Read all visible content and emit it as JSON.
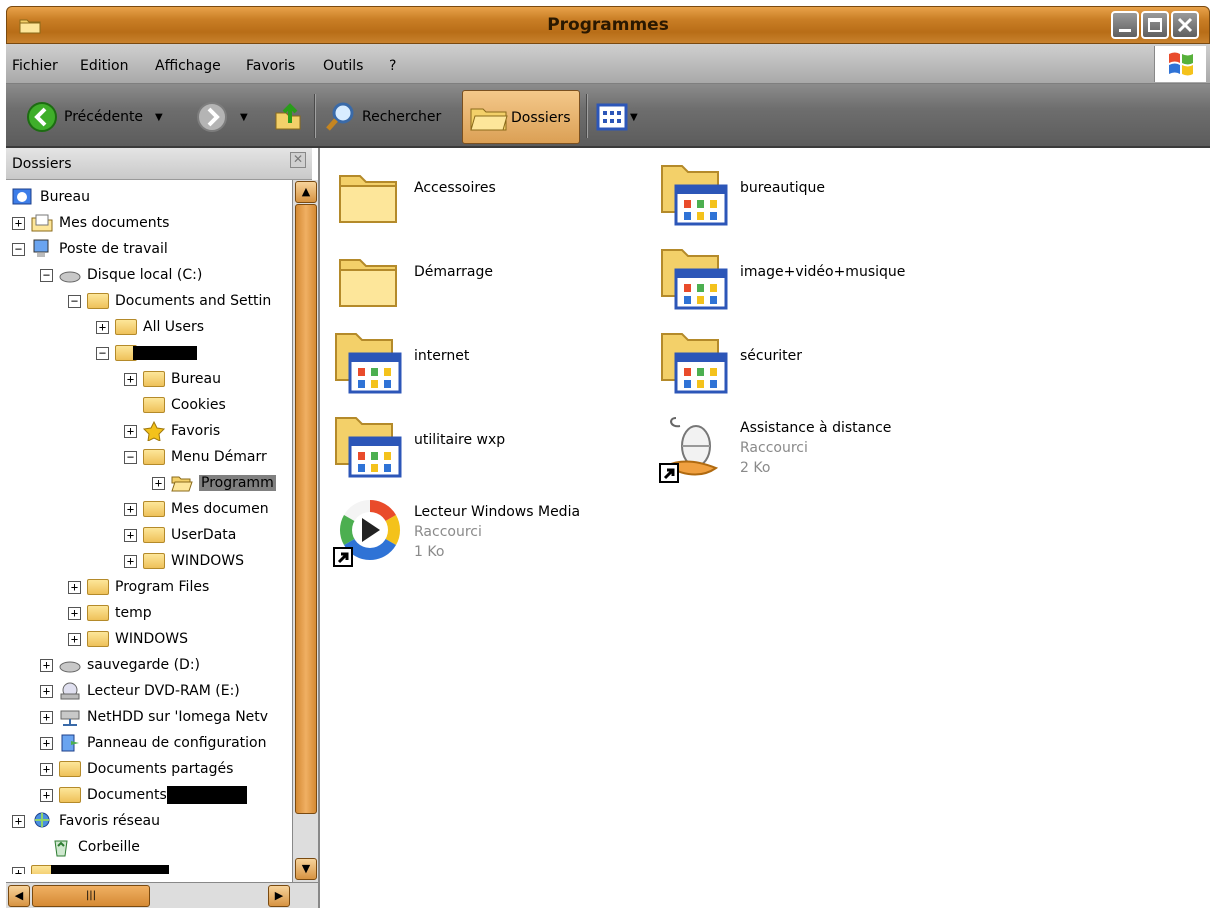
{
  "window": {
    "title": "Programmes",
    "accent": "#c97e25"
  },
  "menubar": {
    "items": [
      "Fichier",
      "Edition",
      "Affichage",
      "Favoris",
      "Outils",
      "?"
    ]
  },
  "toolbar": {
    "back_label": "Précédente",
    "search_label": "Rechercher",
    "folders_label": "Dossiers"
  },
  "folder_pane": {
    "header": "Dossiers",
    "tree": [
      {
        "label": "Bureau",
        "icon": "desktop-icon"
      },
      {
        "label": "Mes documents",
        "icon": "documents-icon"
      },
      {
        "label": "Poste de travail",
        "icon": "computer-icon"
      },
      {
        "label": "Disque local (C:)",
        "icon": "drive-icon"
      },
      {
        "label": "Documents and Settin",
        "icon": "folder-icon"
      },
      {
        "label": "All Users",
        "icon": "folder-icon"
      },
      {
        "label": "",
        "icon": "folder-icon"
      },
      {
        "label": "Bureau",
        "icon": "folder-icon"
      },
      {
        "label": "Cookies",
        "icon": "folder-icon"
      },
      {
        "label": "Favoris",
        "icon": "star-icon"
      },
      {
        "label": "Menu Démarr",
        "icon": "folder-icon"
      },
      {
        "label": "Programm",
        "icon": "folder-open-icon"
      },
      {
        "label": "Mes documen",
        "icon": "folder-icon"
      },
      {
        "label": "UserData",
        "icon": "folder-icon"
      },
      {
        "label": "WINDOWS",
        "icon": "folder-icon"
      },
      {
        "label": "Program Files",
        "icon": "folder-icon"
      },
      {
        "label": "temp",
        "icon": "folder-icon"
      },
      {
        "label": "WINDOWS",
        "icon": "folder-icon"
      },
      {
        "label": "sauvegarde (D:)",
        "icon": "drive-icon"
      },
      {
        "label": "Lecteur DVD-RAM (E:)",
        "icon": "dvd-icon"
      },
      {
        "label": "NetHDD sur 'Iomega Netv",
        "icon": "network-drive-icon"
      },
      {
        "label": "Panneau de configuration",
        "icon": "control-panel-icon"
      },
      {
        "label": "Documents partagés",
        "icon": "folder-icon"
      },
      {
        "label": "Documents",
        "icon": "folder-icon"
      },
      {
        "label": "Favoris réseau",
        "icon": "network-icon"
      },
      {
        "label": "Corbeille",
        "icon": "recycle-bin-icon"
      },
      {
        "label": "",
        "icon": "folder-icon"
      }
    ]
  },
  "content": {
    "items": [
      {
        "name": "Accessoires",
        "type": "folder"
      },
      {
        "name": "bureautique",
        "type": "program-folder"
      },
      {
        "name": "Démarrage",
        "type": "folder"
      },
      {
        "name": "image+vidéo+musique",
        "type": "program-folder"
      },
      {
        "name": "internet",
        "type": "program-folder"
      },
      {
        "name": "sécuriter",
        "type": "program-folder"
      },
      {
        "name": "utilitaire wxp",
        "type": "program-folder"
      },
      {
        "name": "Assistance à distance",
        "type": "shortcut",
        "kind": "Raccourci",
        "size": "2 Ko"
      },
      {
        "name": "Lecteur Windows Media",
        "type": "shortcut",
        "kind": "Raccourci",
        "size": "1 Ko"
      }
    ]
  }
}
